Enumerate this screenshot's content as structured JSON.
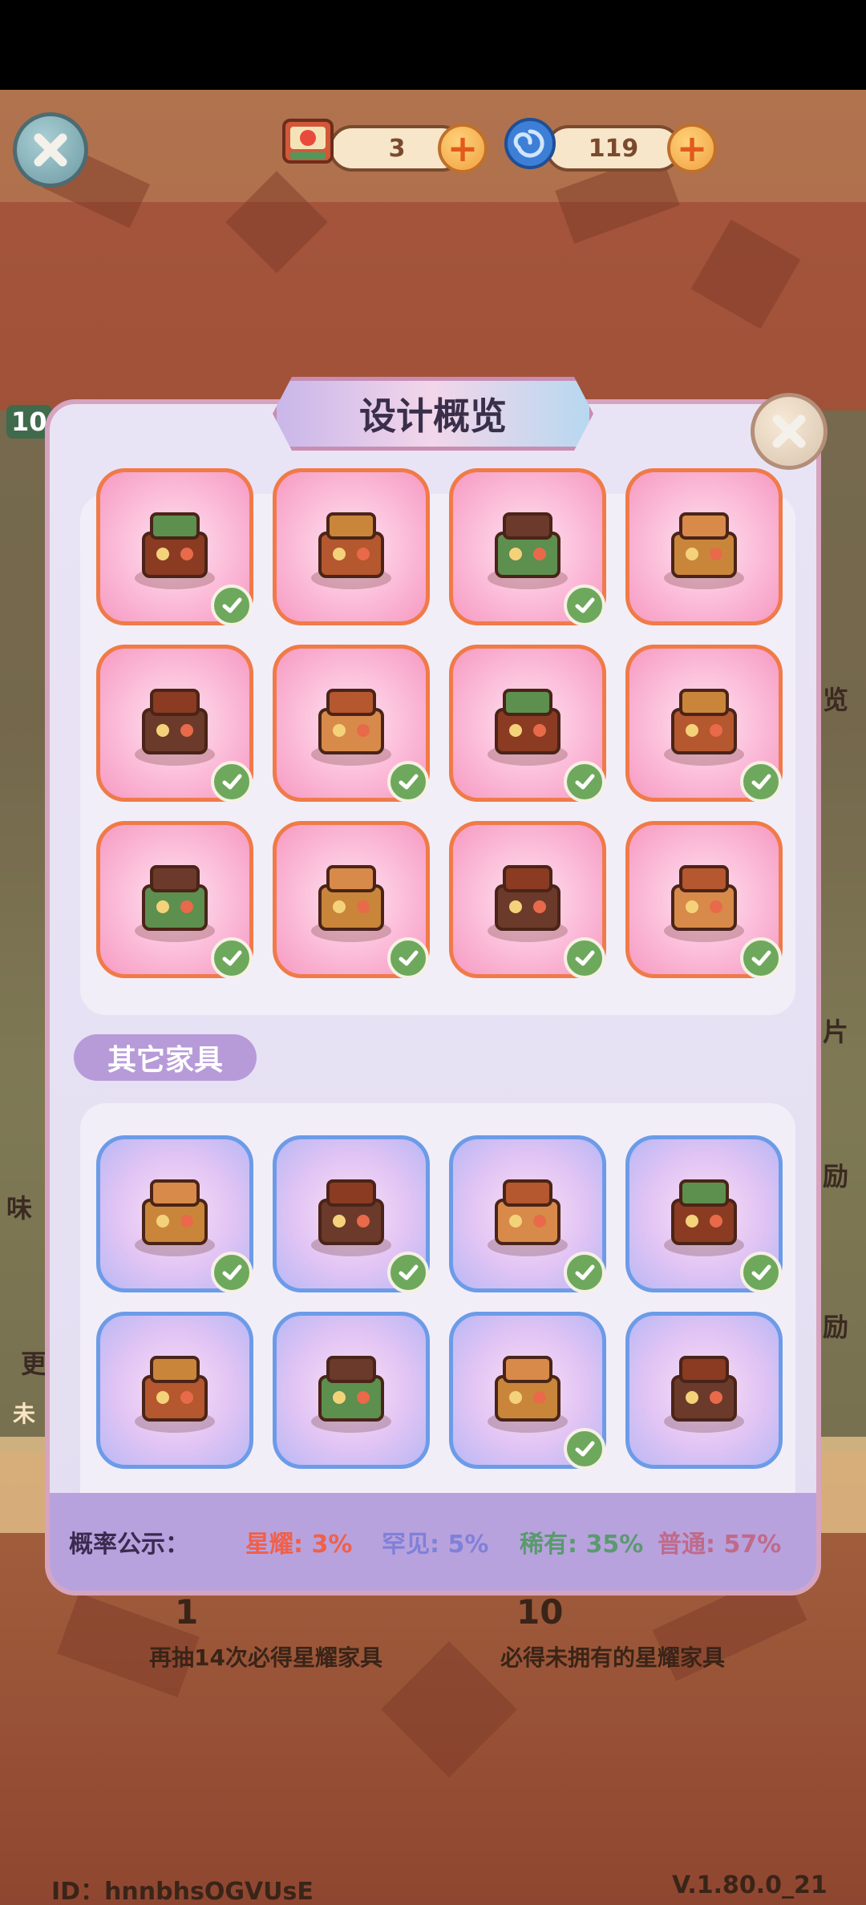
{
  "header": {
    "ticket_count": "3",
    "orb_count": "119"
  },
  "modal": {
    "title": "设计概览",
    "section_other": "其它家具",
    "probability": {
      "label": "概率公示：",
      "star": "星耀: 3%",
      "rare": "罕见: 5%",
      "uncommon": "稀有: 35%",
      "common": "普通: 57%"
    }
  },
  "star_items": [
    {
      "name": "golden-tree-planter",
      "owned": true
    },
    {
      "name": "food-counter",
      "owned": false
    },
    {
      "name": "tea-cart",
      "owned": true
    },
    {
      "name": "arched-window",
      "owned": false
    },
    {
      "name": "poster-wall",
      "owned": true
    },
    {
      "name": "shop-front-stall",
      "owned": true
    },
    {
      "name": "green-stall",
      "owned": true
    },
    {
      "name": "lion-dance-head",
      "owned": true
    },
    {
      "name": "mahjong-table",
      "owned": true
    },
    {
      "name": "dim-sum-set",
      "owned": true
    },
    {
      "name": "hotpot-feast",
      "owned": true
    },
    {
      "name": "tea-snack-set",
      "owned": true
    }
  ],
  "other_items": [
    {
      "name": "bird-swing",
      "owned": true
    },
    {
      "name": "teapot-set",
      "owned": true
    },
    {
      "name": "bead-tree",
      "owned": true
    },
    {
      "name": "scroll-letter",
      "owned": true
    },
    {
      "name": "wooden-stairs",
      "owned": false
    },
    {
      "name": "water-wheel",
      "owned": false
    },
    {
      "name": "pastry-board",
      "owned": true
    },
    {
      "name": "wooden-chest",
      "owned": false
    }
  ],
  "background": {
    "left_tag": "10",
    "left_label_1": "味",
    "left_label_2": "更",
    "left_label_3": "未",
    "right_label_1": "览",
    "right_label_2": "片",
    "right_label_3": "励",
    "right_label_4": "励",
    "draw_one_count": "1",
    "draw_ten_count": "10",
    "draw_one_note": "再抽14次必得星耀家具",
    "draw_ten_note": "必得未拥有的星耀家具",
    "player_id": "ID：hnnbhsOGVUsE",
    "version": "V.1.80.0_21"
  },
  "colors": {
    "star": "#f0604a",
    "rare": "#7f80d8",
    "uncommon": "#5a9a6e",
    "common": "#c06a8a",
    "check": "#6ea85c"
  }
}
